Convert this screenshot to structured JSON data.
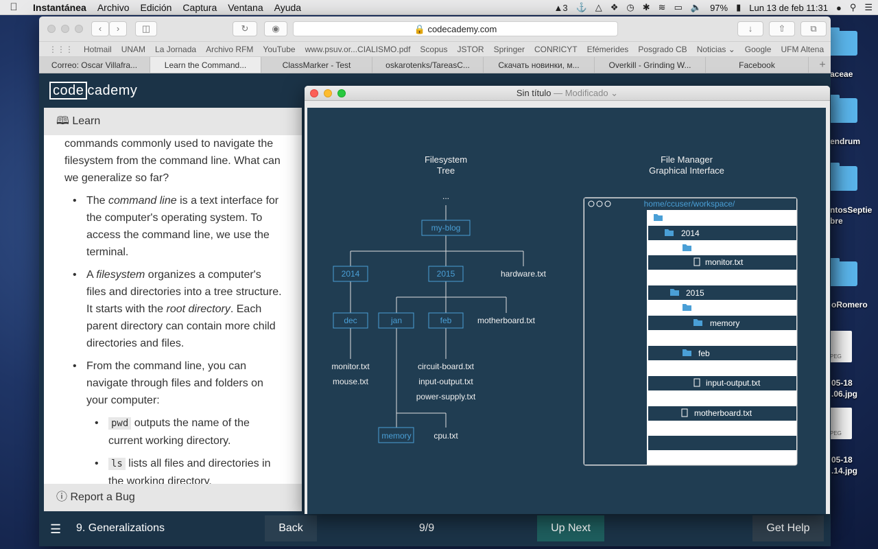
{
  "menubar": {
    "app": "Instantánea",
    "items": [
      "Archivo",
      "Edición",
      "Captura",
      "Ventana",
      "Ayuda"
    ],
    "status": {
      "adobe_count": "3",
      "battery": "97%",
      "datetime": "Lun 13 de feb  11:31"
    }
  },
  "desktop": {
    "labels": [
      "aceae",
      "endrum",
      "ntosSeptie\nbre",
      "oRomero",
      "05-18\n.06.jpg",
      "05-18\n.14.jpg"
    ],
    "jpeg_tag": "PEG"
  },
  "safari": {
    "url": "codecademy.com",
    "bookmarks": [
      "Hotmail",
      "UNAM",
      "La Jornada",
      "Archivo RFM",
      "YouTube",
      "www.psuv.or...CIALISMO.pdf",
      "Scopus",
      "JSTOR",
      "Springer",
      "CONRICYT",
      "Efémerides",
      "Posgrado CB",
      "Noticias ⌄",
      "Google",
      "UFM Altena",
      ">>"
    ],
    "tabs": [
      "Correo: Oscar Villafra...",
      "Learn the Command...",
      "ClassMarker - Test",
      "oskarotenks/TareasC...",
      "Скачать новинки, м...",
      "Overkill - Grinding W...",
      "Facebook"
    ]
  },
  "codecademy": {
    "logo_a": "code",
    "logo_b": "cademy",
    "learn_label": "Learn",
    "intro": "commands commonly used to navigate the filesystem from the command line. What can we generalize so far?",
    "b1_pre": "The ",
    "b1_em": "command line",
    "b1_post": " is a text interface for the computer's operating system. To access the command line, we use the terminal.",
    "b2_pre": "A ",
    "b2_em": "filesystem",
    "b2_mid": " organizes a computer's files and directories into a tree structure. It starts with the ",
    "b2_em2": "root directory",
    "b2_post": ". Each parent directory can contain more child directories and files.",
    "b3": "From the command line, you can navigate through files and folders on your computer:",
    "s1_code": "pwd",
    "s1_text": " outputs the name of the current working directory.",
    "s2_code": "ls",
    "s2_text": " lists all files and directories in the working directory.",
    "report_bug": "Report a Bug",
    "lesson_title": "9. Generalizations",
    "back": "Back",
    "page_count": "9/9",
    "up_next": "Up Next",
    "get_help": "Get Help"
  },
  "preview": {
    "title": "Sin título",
    "modified": " — Modificado ⌄",
    "tree_title_1": "Filesystem",
    "tree_title_2": "Tree",
    "fm_title_1": "File Manager",
    "fm_title_2": "Graphical Interface",
    "tree": {
      "ellipsis": "...",
      "root": "my-blog",
      "n2014": "2014",
      "n2015": "2015",
      "hardware": "hardware.txt",
      "dec": "dec",
      "jan": "jan",
      "feb": "feb",
      "motherboard": "motherboard.txt",
      "monitor": "monitor.txt",
      "mouse": "mouse.txt",
      "circuit": "circuit-board.txt",
      "inputout": "input-output.txt",
      "power": "power-supply.txt",
      "memory": "memory",
      "cpu": "cpu.txt"
    },
    "fm": {
      "path": "home/ccuser/workspace/",
      "r_2014": "2014",
      "r_monitor": "monitor.txt",
      "r_2015": "2015",
      "r_memory": "memory",
      "r_feb": "feb",
      "r_inputout": "input-output.txt",
      "r_motherboard": "motherboard.txt"
    },
    "colors": {
      "node": "#4a9fd6",
      "canvas": "#203d52",
      "row_dark": "#203d52"
    }
  }
}
